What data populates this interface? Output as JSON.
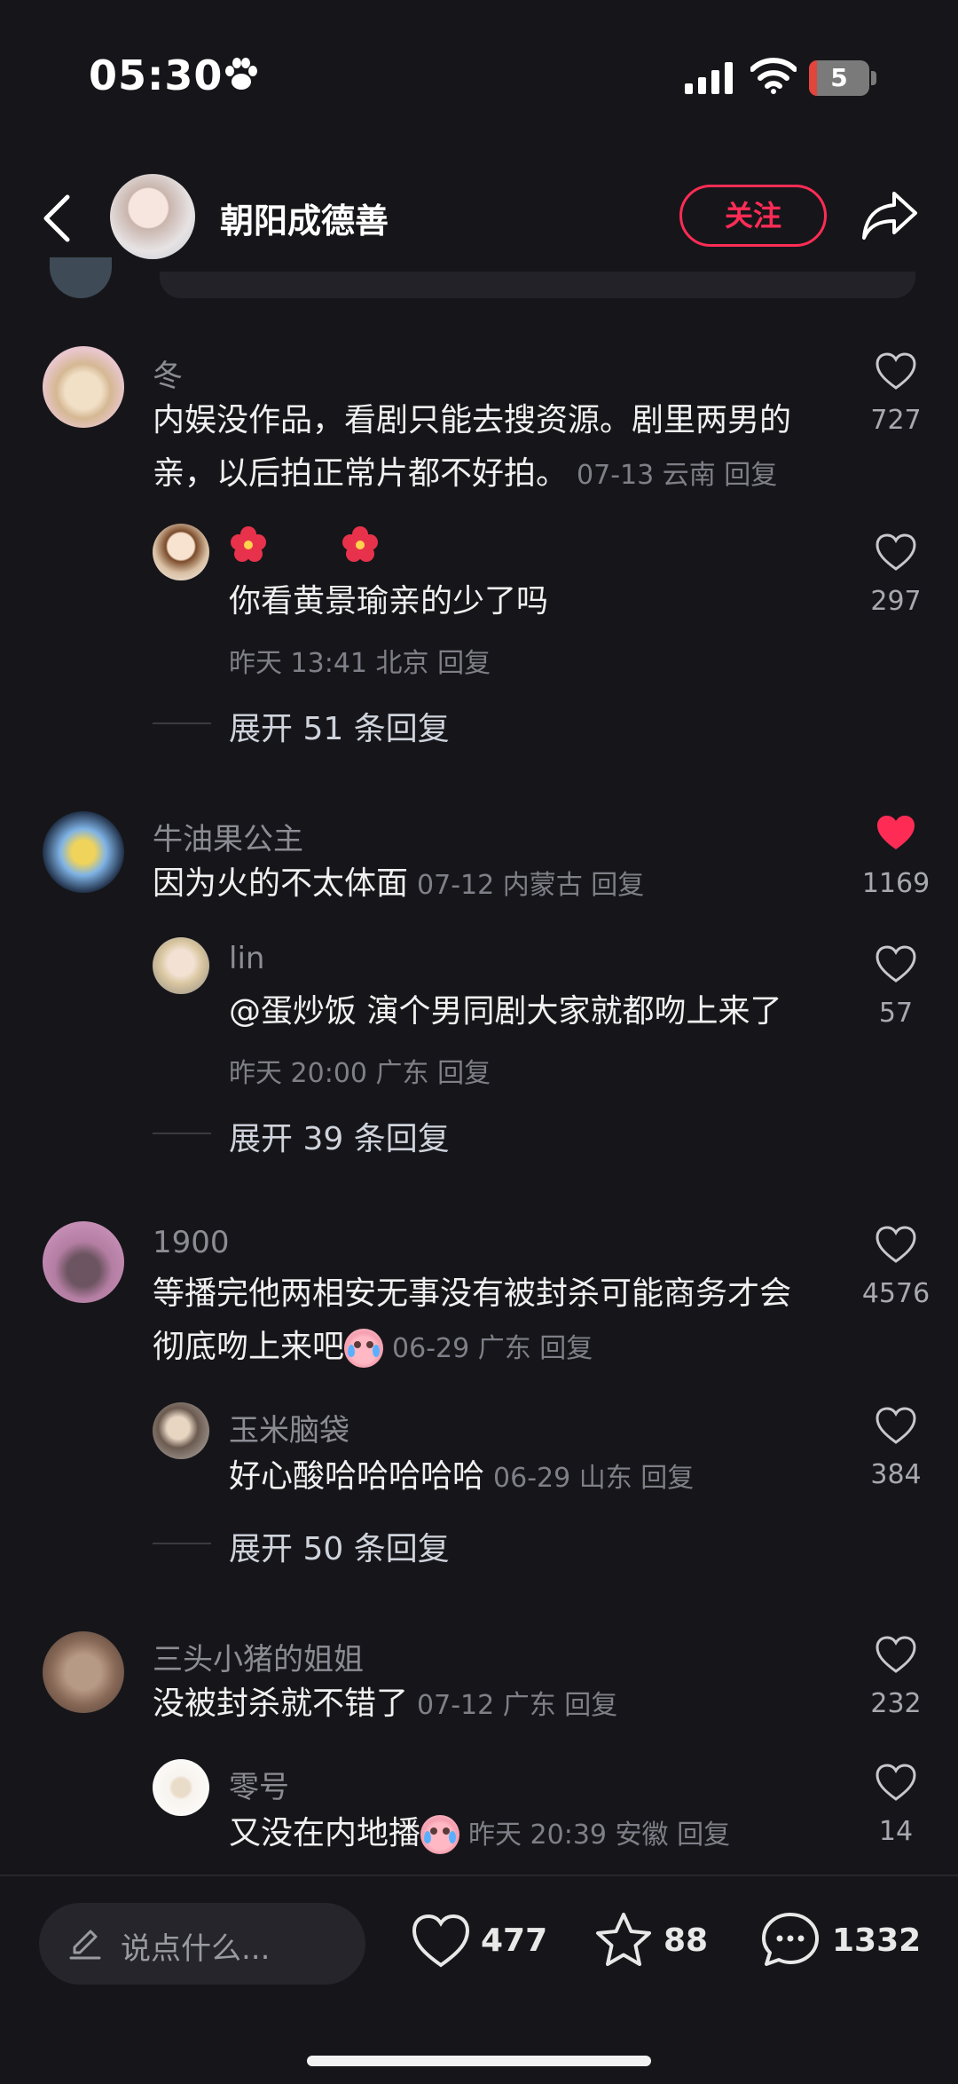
{
  "status": {
    "time": "05:30",
    "battery": "5"
  },
  "header": {
    "author": "朝阳成德善",
    "follow_label": "关注"
  },
  "comments": [
    {
      "user": "冬",
      "lines": [
        "内娱没作品，看剧只能去搜资源。剧里两男的",
        "亲，以后拍正常片都不好拍。"
      ],
      "meta": "07-13 云南 回复",
      "likes": "727",
      "reply": {
        "user": "",
        "text": "你看黄景瑜亲的少了吗",
        "meta": "昨天 13:41 北京 回复",
        "likes": "297"
      },
      "expand": "展开 51 条回复"
    },
    {
      "user": "牛油果公主",
      "lines": [
        "因为火的不太体面"
      ],
      "meta": "07-12 内蒙古 回复",
      "likes": "1169",
      "liked": true,
      "reply": {
        "user": "lin",
        "text": "@蛋炒饭 演个男同剧大家就都吻上来了",
        "meta": "昨天 20:00 广东 回复",
        "likes": "57"
      },
      "expand": "展开 39 条回复"
    },
    {
      "user": "1900",
      "lines": [
        "等播完他两相安无事没有被封杀可能商务才会",
        "彻底吻上来吧"
      ],
      "meta": "06-29 广东 回复",
      "likes": "4576",
      "reply": {
        "user": "玉米脑袋",
        "text": "好心酸哈哈哈哈哈",
        "meta": "06-29 山东 回复",
        "likes": "384"
      },
      "expand": "展开 50 条回复"
    },
    {
      "user": "三头小猪的姐姐",
      "lines": [
        "没被封杀就不错了"
      ],
      "meta": "07-12 广东 回复",
      "likes": "232",
      "reply": {
        "user": "零号",
        "text": "又没在内地播",
        "meta": "昨天 20:39 安徽 回复",
        "likes": "14"
      }
    }
  ],
  "bottom": {
    "placeholder": "说点什么...",
    "likes": "477",
    "favorites": "88",
    "comments": "1332"
  },
  "colors": {
    "accent": "#fe2c55",
    "background": "#16161a"
  },
  "icons": [
    "paw-icon",
    "back-icon",
    "share-icon",
    "heart-icon",
    "star-icon",
    "comment-icon",
    "pencil-icon",
    "flower-icon",
    "crying-emoji-icon"
  ]
}
